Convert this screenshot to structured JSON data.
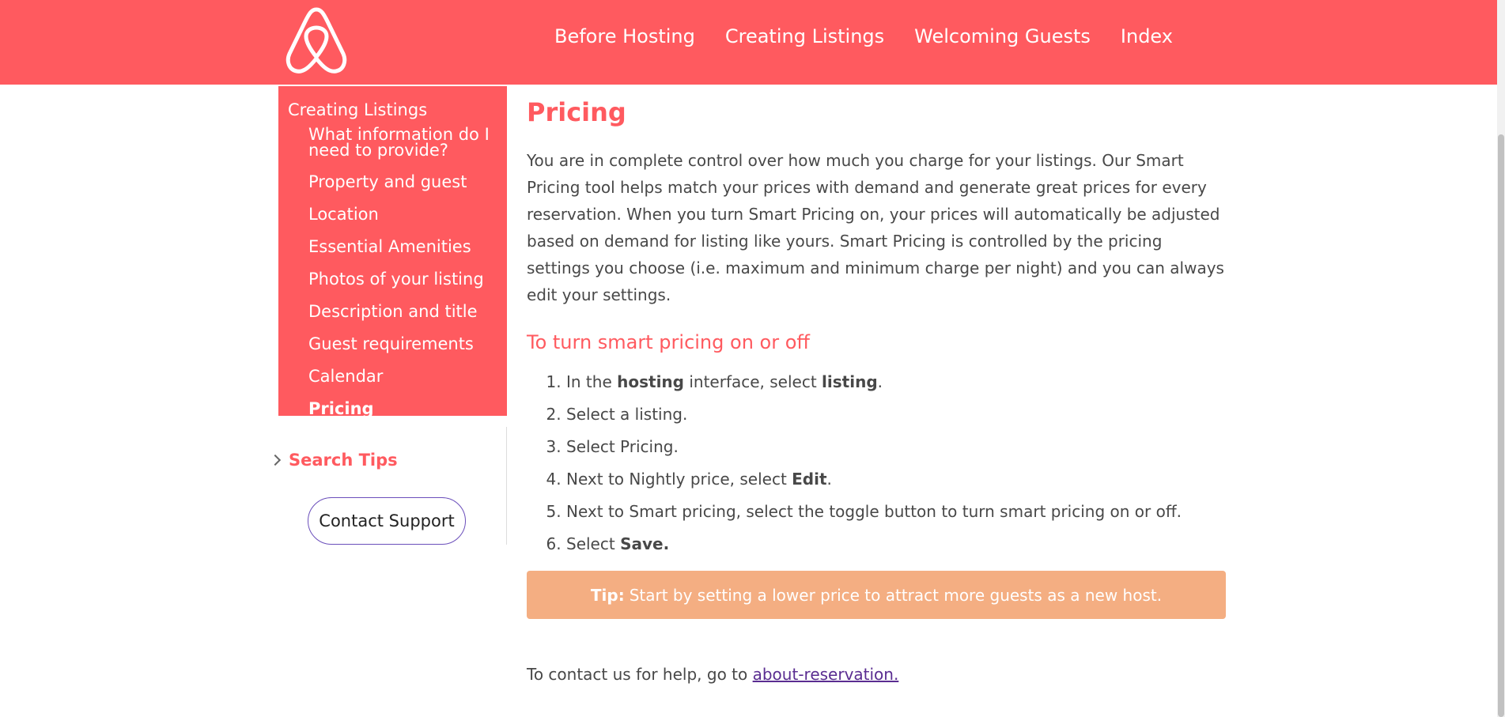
{
  "header": {
    "nav": [
      "Before Hosting",
      "Creating Listings",
      "Welcoming Guests",
      "Index"
    ]
  },
  "sidebar": {
    "section_title": "Creating Listings",
    "items": [
      "What information do I need to provide?",
      "Property and guest",
      "Location",
      "Essential Amenities",
      "Photos of your listing",
      "Description and title",
      "Guest requirements",
      "Calendar",
      "Pricing"
    ],
    "active_item": "Pricing",
    "search_tips": "Search Tips",
    "contact_button": "Contact Support"
  },
  "main": {
    "title": "Pricing",
    "intro": "You are in complete control over how much you charge for your listings. Our Smart Pricing tool helps match your prices with demand and generate great prices for every reservation. When you turn Smart Pricing on, your prices will automatically be adjusted based on demand for listing like yours. Smart Pricing is controlled by the pricing settings you choose (i.e. maximum and minimum charge per night) and you can always edit your settings.",
    "subheading": "To turn smart pricing on or off",
    "steps": [
      {
        "pre": "In the ",
        "b1": "hosting",
        "mid": " interface, select ",
        "b2": "listing",
        "post": "."
      },
      {
        "pre": "Select a listing."
      },
      {
        "pre": "Select Pricing."
      },
      {
        "pre": "Next to Nightly price, select ",
        "b1": "Edit",
        "mid": "."
      },
      {
        "pre": "Next to Smart pricing, select the toggle button to turn smart pricing on or off."
      },
      {
        "pre": "Select ",
        "b1": "Save."
      }
    ],
    "tip_label": "Tip:",
    "tip_text": "Start by setting a lower price to attract more guests as a new host.",
    "contact_text": "To contact us for help, go to ",
    "contact_link": "about-reservation."
  },
  "colors": {
    "brand": "#ff5a5f",
    "tip_bg": "#f4ae82",
    "link": "#5a2d91"
  },
  "icons": [
    "airbnb-logo-icon",
    "chevron-right-icon"
  ]
}
